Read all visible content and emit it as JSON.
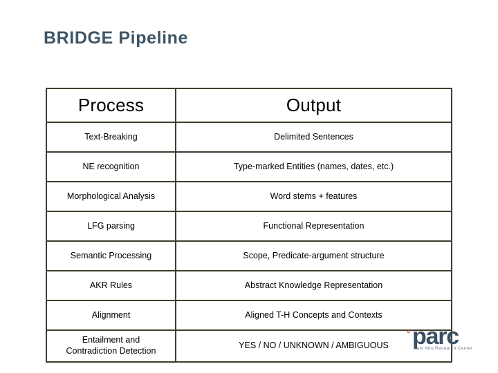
{
  "slide": {
    "title": "BRIDGE Pipeline",
    "title_color": "#3d5566",
    "background_color": "#ffffff"
  },
  "table": {
    "border_color": "#3f3d2e",
    "headers": {
      "process": "Process",
      "output": "Output"
    },
    "rows": [
      {
        "process": "Text-Breaking",
        "output": "Delimited Sentences",
        "output_color": "#000000"
      },
      {
        "process": "NE recognition",
        "output": "Type-marked Entities (names, dates, etc.)",
        "output_color": "#000000"
      },
      {
        "process": "Morphological Analysis",
        "output": "Word stems + features",
        "output_color": "#000000"
      },
      {
        "process": "LFG parsing",
        "output": "Functional Representation",
        "output_color": "#000000"
      },
      {
        "process": "Semantic Processing",
        "output": "Scope, Predicate-argument structure",
        "output_color": "#000000"
      },
      {
        "process": "AKR Rules",
        "output": "Abstract Knowledge Representation",
        "output_color": "#a8492f"
      },
      {
        "process": "Alignment",
        "output": "Aligned T-H Concepts and Contexts",
        "output_color": "#c0342b"
      },
      {
        "process": "Entailment and\nContradiction Detection",
        "output": "YES / NO / UNKNOWN / AMBIGUOUS",
        "output_color": "#c0342b"
      }
    ]
  },
  "logo": {
    "mark": "°",
    "wordmark": "parc",
    "tagline": "Palo Alto Research Center",
    "wordmark_color": "#3c5063",
    "mark_color": "#b03a2e"
  }
}
